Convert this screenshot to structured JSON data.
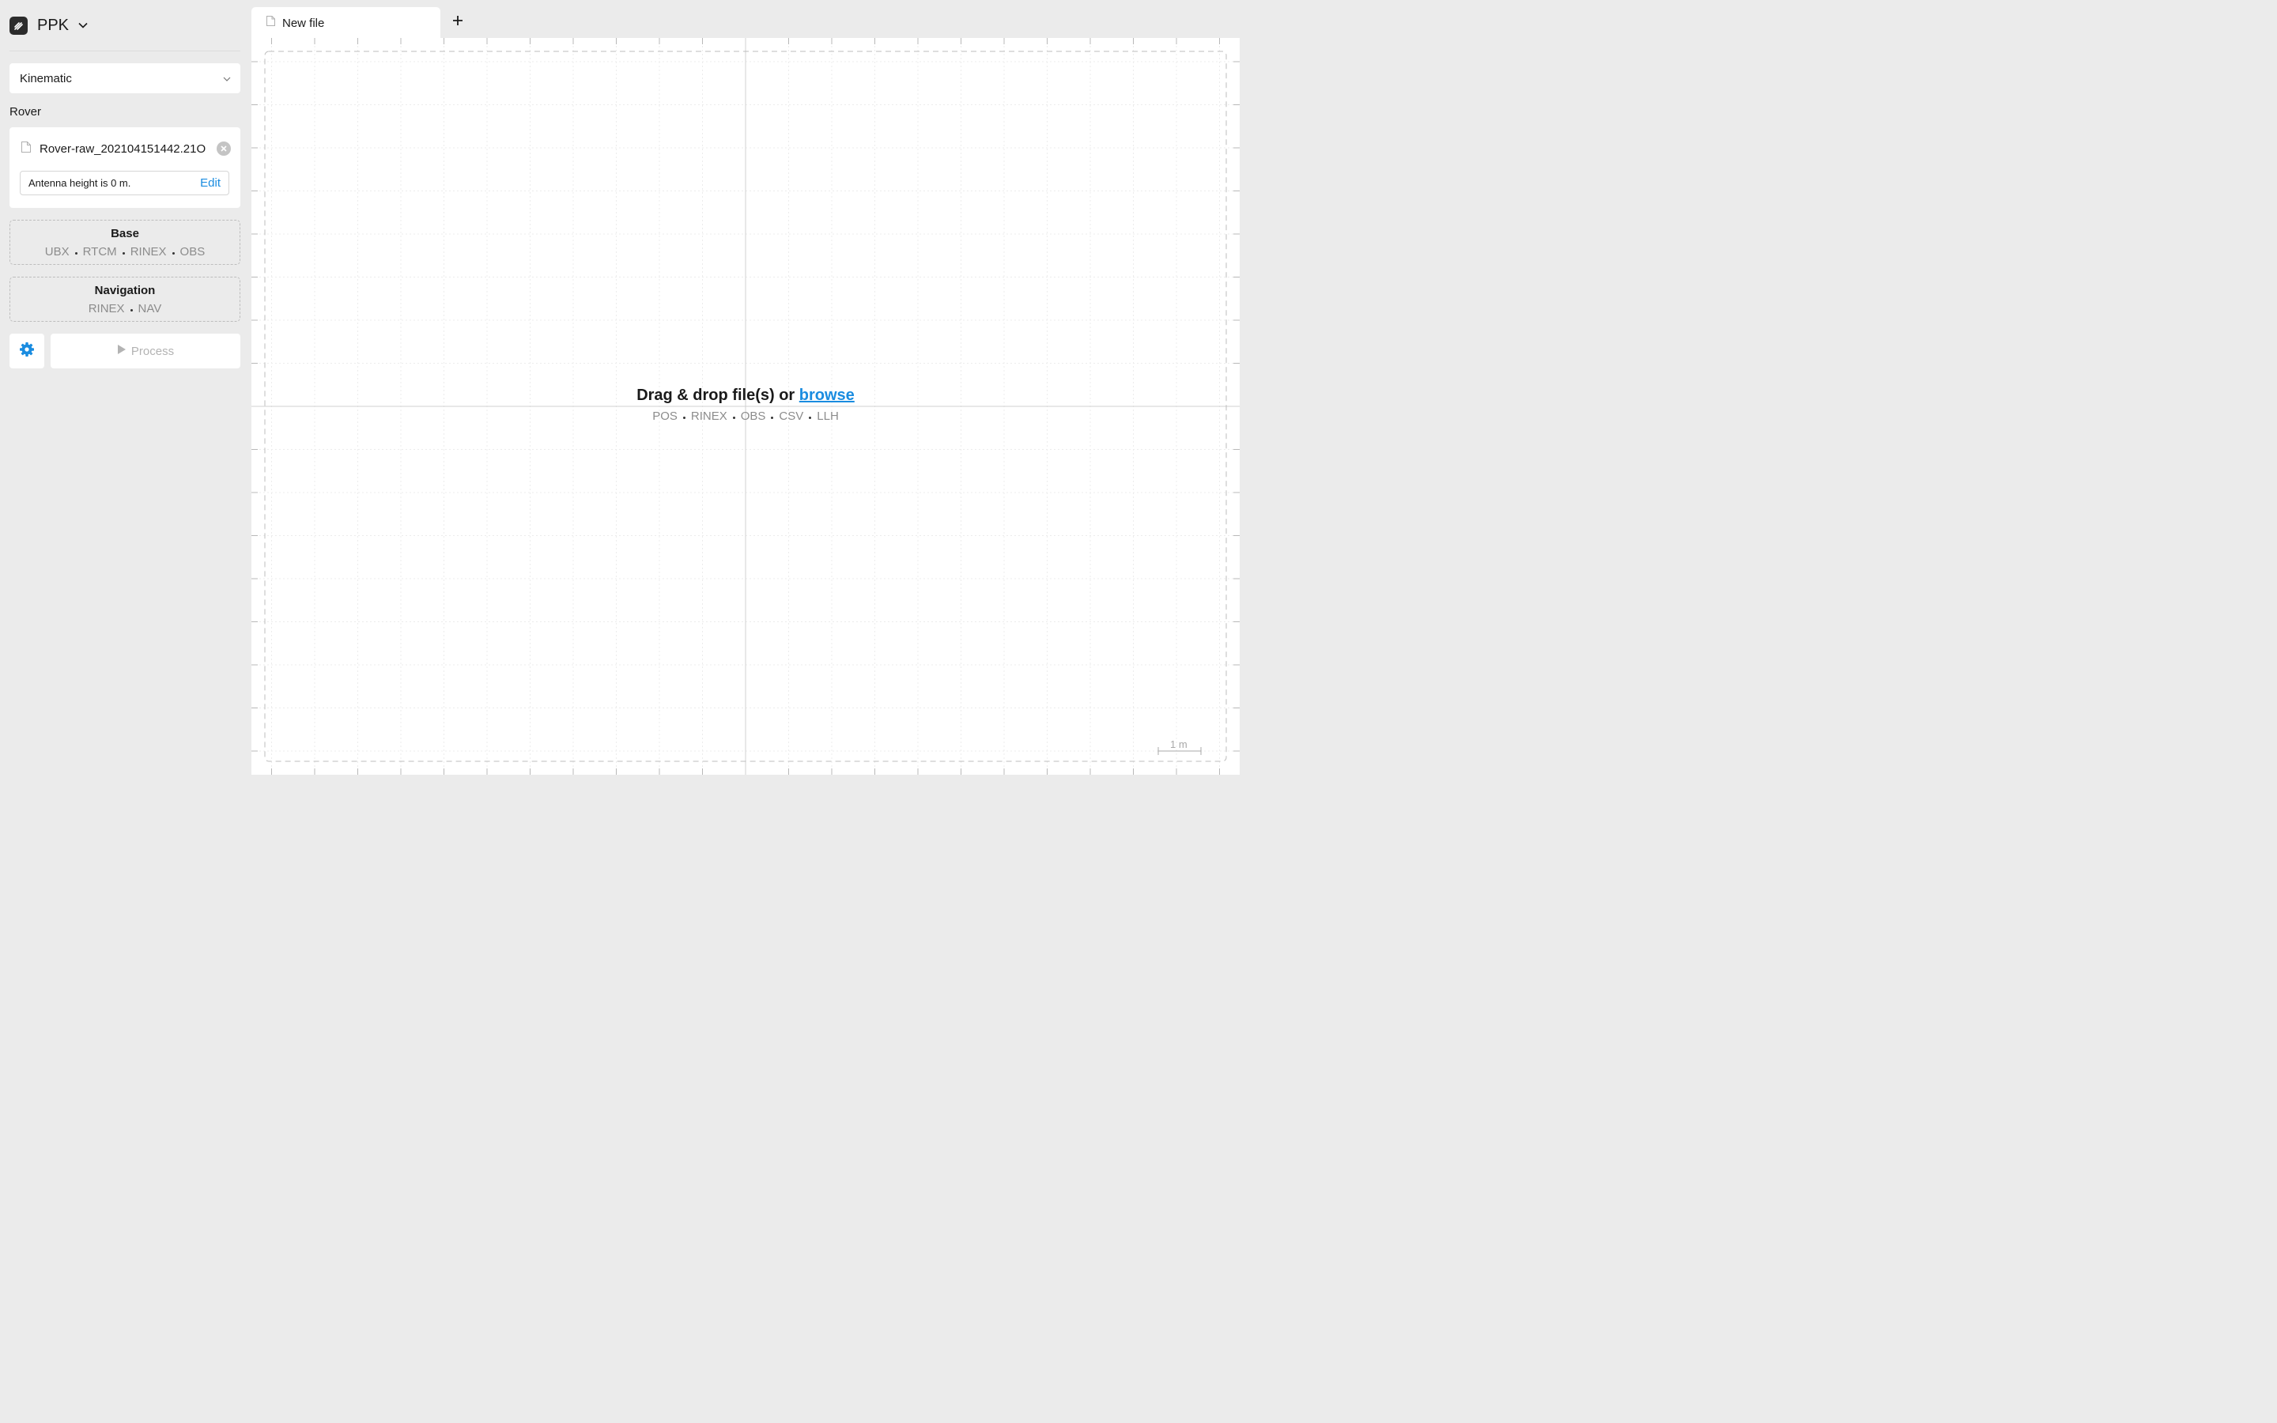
{
  "app": {
    "title": "PPK"
  },
  "mode": {
    "value": "Kinematic"
  },
  "rover": {
    "label": "Rover",
    "file_name": "Rover-raw_202104151442.21O",
    "antenna_text": "Antenna height is 0 m.",
    "edit_label": "Edit"
  },
  "base": {
    "title": "Base",
    "formats": [
      "UBX",
      "RTCM",
      "RINEX",
      "OBS"
    ]
  },
  "navigation": {
    "title": "Navigation",
    "formats": [
      "RINEX",
      "NAV"
    ]
  },
  "process": {
    "label": "Process"
  },
  "tabs": [
    {
      "label": "New file"
    }
  ],
  "canvas": {
    "drop_text": "Drag & drop file(s) or ",
    "browse_label": "browse",
    "formats": [
      "POS",
      "RINEX",
      "OBS",
      "CSV",
      "LLH"
    ],
    "scale_label": "1 m"
  },
  "colors": {
    "accent": "#1a8ce0",
    "sidebar_bg": "#ebebeb",
    "muted_text": "#8c8c8c"
  },
  "icons": {
    "logo": "pen-logo-icon",
    "chevron": "chevron-down-icon",
    "file": "file-icon",
    "clear": "close-circle-icon",
    "settings": "gear-icon",
    "play": "play-icon",
    "add": "plus-icon"
  }
}
